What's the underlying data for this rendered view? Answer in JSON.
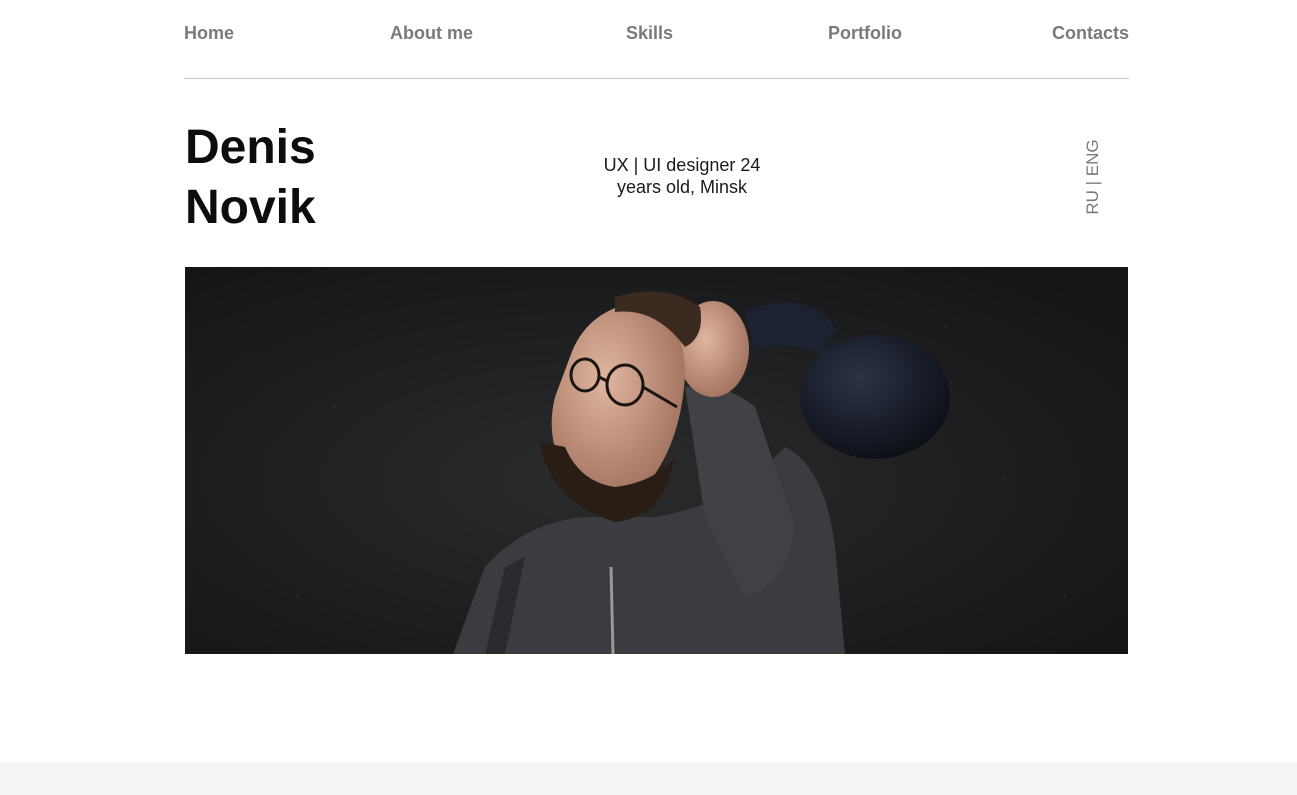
{
  "nav": {
    "items": [
      {
        "label": "Home"
      },
      {
        "label": "About me"
      },
      {
        "label": "Skills"
      },
      {
        "label": "Portfolio"
      },
      {
        "label": "Contacts"
      }
    ]
  },
  "hero": {
    "first_name": "Denis",
    "last_name": "Novik",
    "tagline_line1": "UX | UI designer 24",
    "tagline_line2": "years old, Minsk",
    "language_switch": "RU | ENG"
  },
  "colors": {
    "nav_text": "#7a7a7a",
    "name_text": "#0d0d0d",
    "divider": "#c8c8c8",
    "photo_background": "#1c1d1f",
    "footer_band": "#f5f5f5"
  }
}
